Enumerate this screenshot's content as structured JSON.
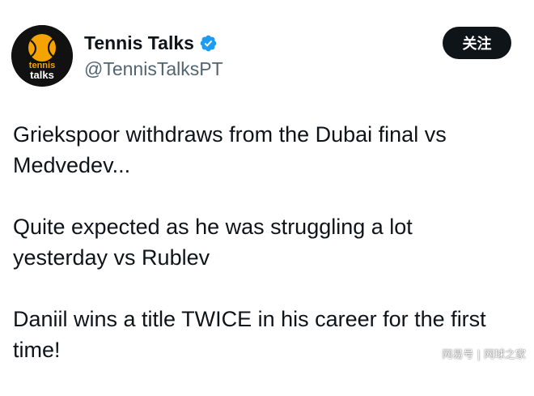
{
  "account": {
    "display_name": "Tennis Talks",
    "handle": "@TennisTalksPT",
    "verified": true,
    "avatar_text_line1": "tennis",
    "avatar_text_line2": "talks"
  },
  "follow_button": {
    "label": "关注"
  },
  "tweet": {
    "paragraphs": [
      "Griekspoor withdraws from the Dubai final vs\nMedvedev...",
      "Quite expected as he was struggling a lot\nyesterday vs Rublev",
      "Daniil wins a title TWICE in his career for the first\ntime!"
    ]
  },
  "watermark": {
    "text": "网易号 | 网球之家"
  },
  "colors": {
    "text": "#0f1419",
    "secondary_text": "#536471",
    "verified_blue": "#1d9bf0",
    "follow_button_bg": "#0f1419",
    "avatar_bg": "#111111",
    "avatar_accent": "#f5a300"
  },
  "icons": {
    "verified": "verified-badge-icon",
    "avatar": "tennis-ball-logo-icon"
  }
}
